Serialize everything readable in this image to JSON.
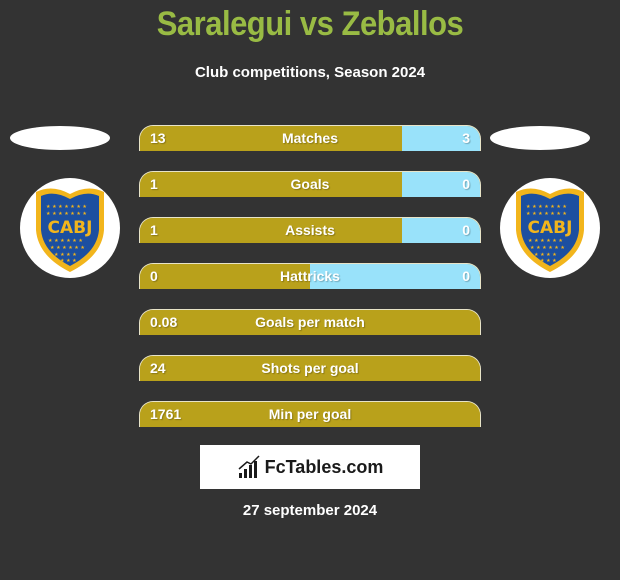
{
  "header": {
    "title": "Saralegui vs Zeballos",
    "subtitle": "Club competitions, Season 2024"
  },
  "players": {
    "left": {
      "name": "Saralegui",
      "club_badge_text": "CABJ"
    },
    "right": {
      "name": "Zeballos",
      "club_badge_text": "CABJ"
    }
  },
  "colors": {
    "title": "#99bb44",
    "left_bar": "#b9a11b",
    "right_bar": "#99e2fa",
    "background": "#333333"
  },
  "stats": [
    {
      "label": "Matches",
      "left": "13",
      "right": "3",
      "left_share": 0.77
    },
    {
      "label": "Goals",
      "left": "1",
      "right": "0",
      "left_share": 0.77
    },
    {
      "label": "Assists",
      "left": "1",
      "right": "0",
      "left_share": 0.77
    },
    {
      "label": "Hattricks",
      "left": "0",
      "right": "0",
      "left_share": 0.5
    },
    {
      "label": "Goals per match",
      "left": "0.08",
      "right": "",
      "left_share": 1
    },
    {
      "label": "Shots per goal",
      "left": "24",
      "right": "",
      "left_share": 1
    },
    {
      "label": "Min per goal",
      "left": "1761",
      "right": "",
      "left_share": 1
    }
  ],
  "footer": {
    "brand": "FcTables.com",
    "brand_icon": "bar-chart-icon",
    "date": "27 september 2024"
  }
}
